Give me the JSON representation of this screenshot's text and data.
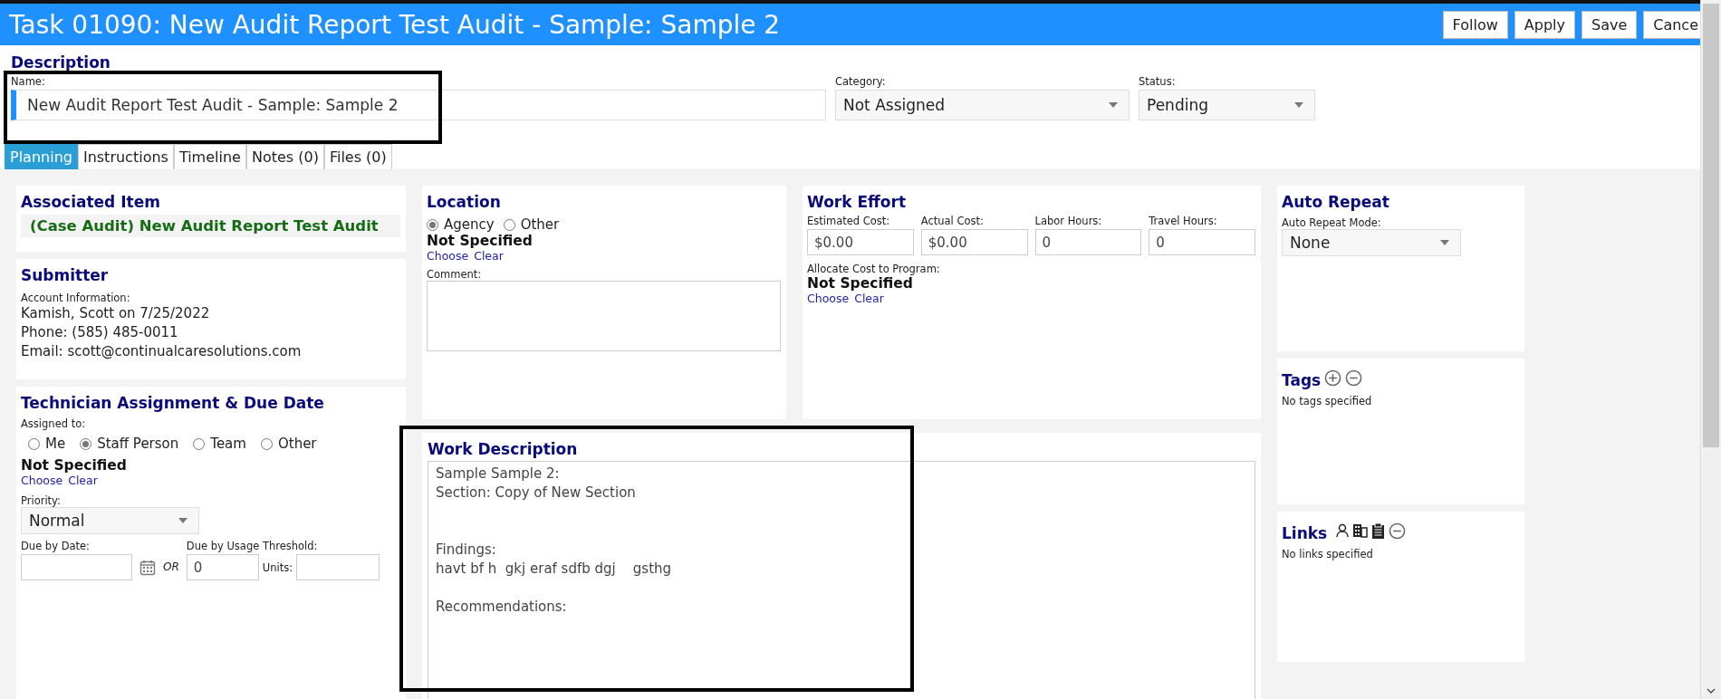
{
  "window": {
    "title": "Task 01090: New Audit Report Test Audit - Sample: Sample 2"
  },
  "header_buttons": [
    "Follow",
    "Apply",
    "Save",
    "Cance"
  ],
  "description": {
    "heading": "Description",
    "name": {
      "label": "Name:",
      "value": "New Audit Report Test Audit - Sample: Sample 2"
    },
    "category": {
      "label": "Category:",
      "value": "Not Assigned"
    },
    "status": {
      "label": "Status:",
      "value": "Pending"
    }
  },
  "tabs": [
    {
      "label": "Planning",
      "selected": true
    },
    {
      "label": "Instructions",
      "selected": false
    },
    {
      "label": "Timeline",
      "selected": false
    },
    {
      "label": "Notes (0)",
      "selected": false
    },
    {
      "label": "Files (0)",
      "selected": false
    }
  ],
  "associated_item": {
    "heading": "Associated Item",
    "value": "(Case Audit) New Audit Report Test Audit"
  },
  "submitter": {
    "heading": "Submitter",
    "label": "Account Information:",
    "lines": [
      "Kamish, Scott on 7/25/2022",
      "Phone: (585) 485-0011",
      "Email: scott@continualcaresolutions.com"
    ]
  },
  "technician": {
    "heading": "Technician Assignment & Due Date",
    "assigned_label": "Assigned to:",
    "assigned_options": [
      {
        "label": "Me",
        "selected": false
      },
      {
        "label": "Staff Person",
        "selected": true
      },
      {
        "label": "Team",
        "selected": false
      },
      {
        "label": "Other",
        "selected": false
      }
    ],
    "assignee": "Not Specified",
    "links": [
      "Choose",
      "Clear"
    ],
    "priority": {
      "label": "Priority:",
      "value": "Normal"
    },
    "due_date": {
      "label": "Due by Date:"
    },
    "or_label": "OR",
    "usage": {
      "label": "Due by Usage Threshold:",
      "value": "0"
    },
    "units": {
      "label": "Units:"
    }
  },
  "location": {
    "heading": "Location",
    "options": [
      {
        "label": "Agency",
        "selected": true
      },
      {
        "label": "Other",
        "selected": false
      }
    ],
    "value": "Not Specified",
    "links": [
      "Choose",
      "Clear"
    ],
    "comment": {
      "label": "Comment:"
    }
  },
  "work_effort": {
    "heading": "Work Effort",
    "fields": [
      {
        "label": "Estimated Cost:",
        "value": "$0.00"
      },
      {
        "label": "Actual Cost:",
        "value": "$0.00"
      },
      {
        "label": "Labor Hours:",
        "value": "0"
      },
      {
        "label": "Travel Hours:",
        "value": "0"
      }
    ],
    "allocate_label": "Allocate Cost to Program:",
    "allocate_value": "Not Specified",
    "links": [
      "Choose",
      "Clear"
    ]
  },
  "work_description": {
    "heading": "Work Description",
    "text": "Sample Sample 2:\nSection: Copy of New Section\n\n\nFindings:\nhavt bf h  gkj eraf sdfb dgj    gsthg\n\nRecommendations:"
  },
  "auto_repeat": {
    "heading": "Auto Repeat",
    "mode": {
      "label": "Auto Repeat Mode:",
      "value": "None"
    }
  },
  "tags": {
    "heading": "Tags",
    "empty": "No tags specified"
  },
  "links": {
    "heading": "Links",
    "empty": "No links specified"
  }
}
